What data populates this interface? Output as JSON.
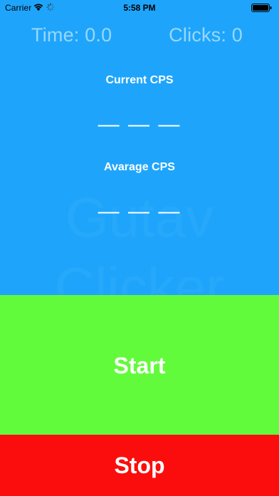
{
  "status_bar": {
    "carrier": "Carrier",
    "time": "5:58 PM",
    "icons": [
      "wifi-icon",
      "activity-spinner-icon",
      "battery-icon"
    ]
  },
  "stats": {
    "time_label": "Time: 0.0",
    "clicks_label": "Clicks: 0"
  },
  "background_watermark": {
    "line1": "Gutav",
    "line2": "Clicker"
  },
  "current_cps": {
    "label": "Current CPS",
    "value": "— — —"
  },
  "average_cps": {
    "label": "Avarage CPS",
    "value": "— — —"
  },
  "buttons": {
    "start_label": "Start",
    "stop_label": "Stop"
  },
  "colors": {
    "top_background": "#1ea5fb",
    "start_background": "#62fb3c",
    "stop_background": "#fc0d0d",
    "text": "#ffffff"
  }
}
